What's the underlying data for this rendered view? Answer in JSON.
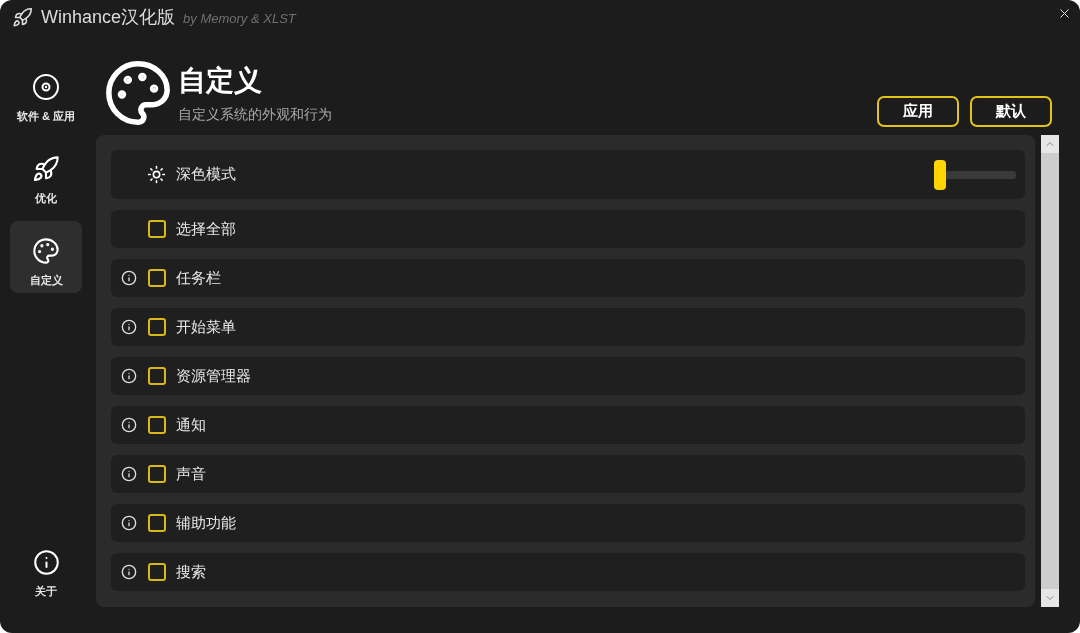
{
  "window": {
    "title": "Winhance汉化版",
    "subtitle": "by Memory & XLST"
  },
  "sidebar": {
    "items": [
      {
        "label": "软件 & 应用",
        "selected": false
      },
      {
        "label": "优化",
        "selected": false
      },
      {
        "label": "自定义",
        "selected": true
      }
    ],
    "footer_items": [
      {
        "label": "关于",
        "selected": false
      }
    ]
  },
  "header": {
    "title": "自定义",
    "description": "自定义系统的外观和行为"
  },
  "buttons": [
    {
      "label": "应用"
    },
    {
      "label": "默认"
    }
  ],
  "settings": [
    {
      "kind": "toggle",
      "label": "深色模式",
      "on": false
    },
    {
      "kind": "checkbox",
      "label": "选择全部",
      "checked": false,
      "info": false
    },
    {
      "kind": "checkbox",
      "label": "任务栏",
      "checked": false,
      "info": true
    },
    {
      "kind": "checkbox",
      "label": "开始菜单",
      "checked": false,
      "info": true
    },
    {
      "kind": "checkbox",
      "label": "资源管理器",
      "checked": false,
      "info": true
    },
    {
      "kind": "checkbox",
      "label": "通知",
      "checked": false,
      "info": true
    },
    {
      "kind": "checkbox",
      "label": "声音",
      "checked": false,
      "info": true
    },
    {
      "kind": "checkbox",
      "label": "辅助功能",
      "checked": false,
      "info": true
    },
    {
      "kind": "checkbox",
      "label": "搜索",
      "checked": false,
      "info": true
    }
  ]
}
